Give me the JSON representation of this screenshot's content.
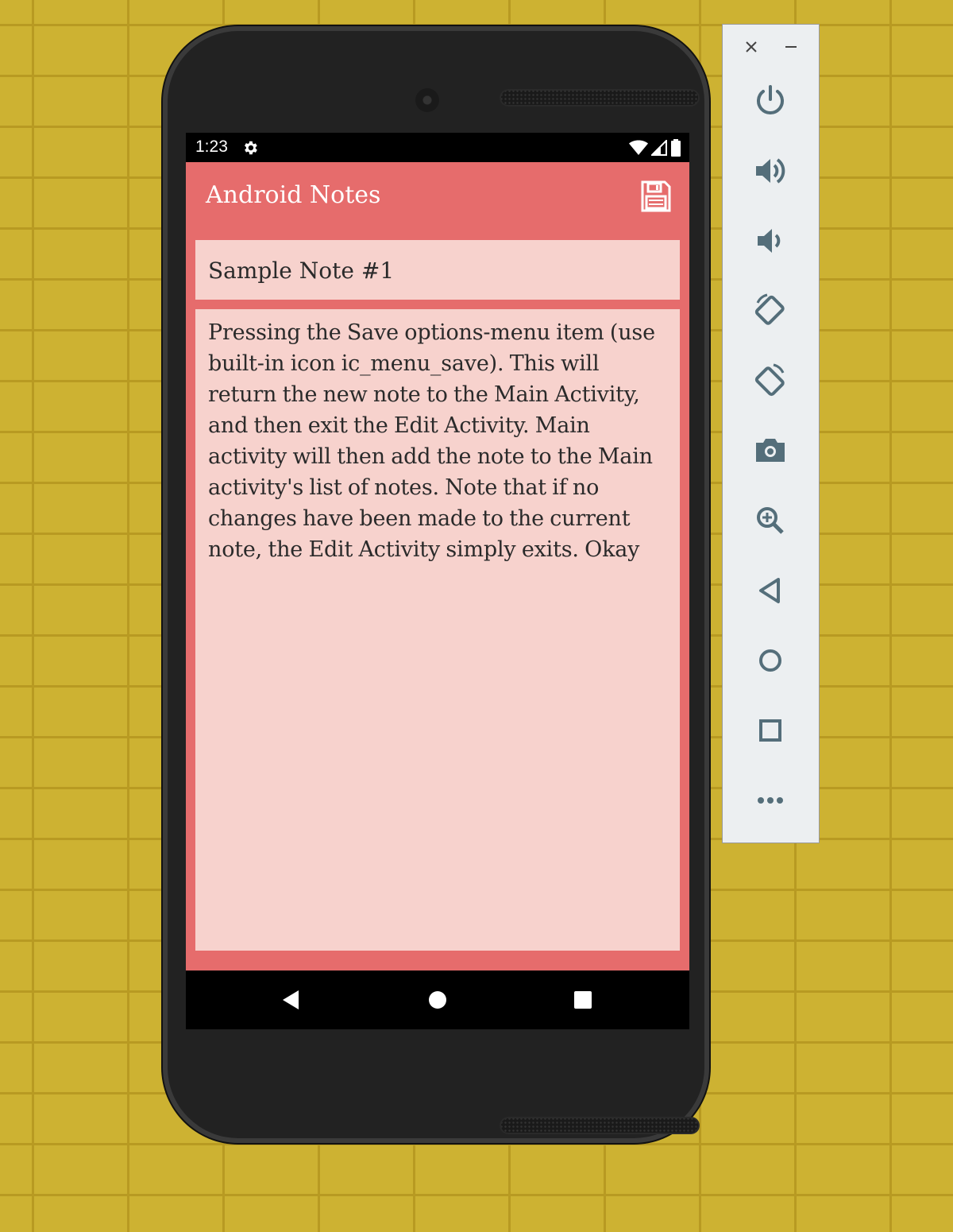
{
  "status_bar": {
    "time": "1:23",
    "icons": [
      "settings-icon",
      "wifi-icon",
      "signal-icon",
      "battery-icon"
    ]
  },
  "app_bar": {
    "title": "Android Notes",
    "action_icon": "save-icon"
  },
  "note": {
    "title": "Sample Note #1",
    "body": "Pressing the Save options-menu item (use built-in icon ic_menu_save). This will return the new note to the Main Activity, and then exit the Edit Activity. Main activity will then add the note to the Main activity's list of notes. Note that if no changes have been made to the current note, the Edit Activity simply exits. Okay"
  },
  "nav_bar": {
    "buttons": [
      "back-icon",
      "home-icon",
      "recents-icon"
    ]
  },
  "emulator_panel": {
    "window_controls": [
      "close-icon",
      "minimize-icon"
    ],
    "tools": [
      "power-icon",
      "volume-up-icon",
      "volume-down-icon",
      "rotate-left-icon",
      "rotate-right-icon",
      "camera-icon",
      "zoom-icon",
      "back-icon",
      "home-icon",
      "overview-icon",
      "more-icon"
    ]
  },
  "colors": {
    "accent": "#e66c6c",
    "field_bg": "#f7d2cd",
    "background": "#cdb232",
    "panel_icon": "#546e7a"
  }
}
